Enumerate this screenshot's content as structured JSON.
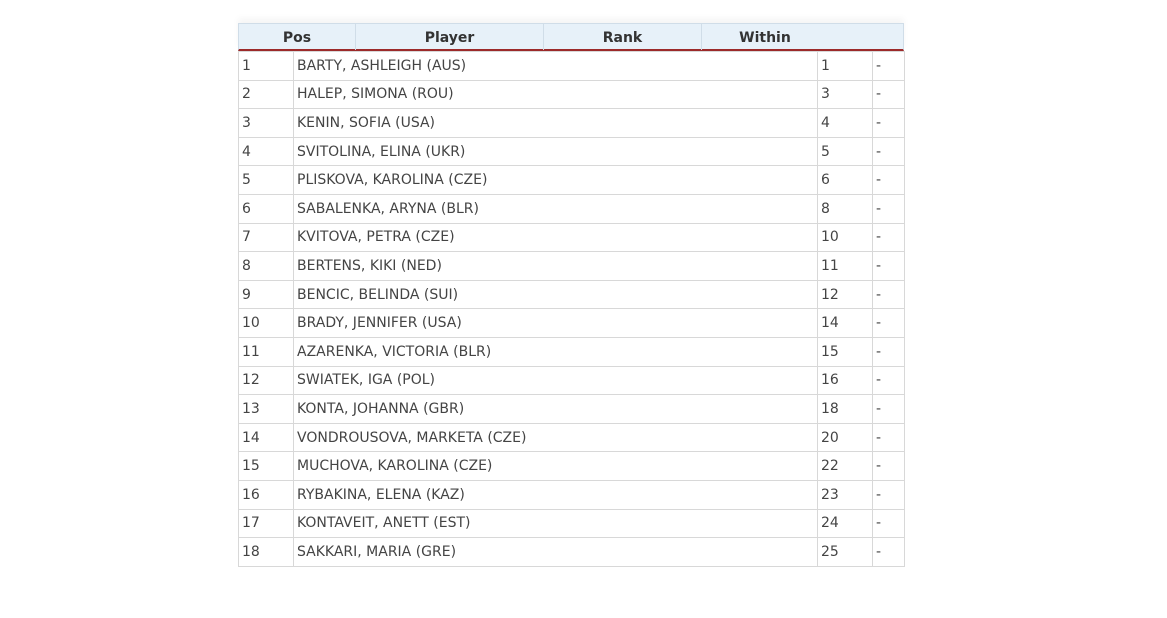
{
  "table": {
    "headers": {
      "pos": "Pos",
      "player": "Player",
      "rank": "Rank",
      "within": "Within"
    },
    "rows": [
      {
        "pos": "1",
        "player": "BARTY, ASHLEIGH (AUS)",
        "rank": "1",
        "within": "-"
      },
      {
        "pos": "2",
        "player": "HALEP, SIMONA (ROU)",
        "rank": "3",
        "within": "-"
      },
      {
        "pos": "3",
        "player": "KENIN, SOFIA (USA)",
        "rank": "4",
        "within": "-"
      },
      {
        "pos": "4",
        "player": "SVITOLINA, ELINA (UKR)",
        "rank": "5",
        "within": "-"
      },
      {
        "pos": "5",
        "player": "PLISKOVA, KAROLINA (CZE)",
        "rank": "6",
        "within": "-"
      },
      {
        "pos": "6",
        "player": "SABALENKA, ARYNA (BLR)",
        "rank": "8",
        "within": "-"
      },
      {
        "pos": "7",
        "player": "KVITOVA, PETRA (CZE)",
        "rank": "10",
        "within": "-"
      },
      {
        "pos": "8",
        "player": "BERTENS, KIKI (NED)",
        "rank": "11",
        "within": "-"
      },
      {
        "pos": "9",
        "player": "BENCIC, BELINDA (SUI)",
        "rank": "12",
        "within": "-"
      },
      {
        "pos": "10",
        "player": "BRADY, JENNIFER (USA)",
        "rank": "14",
        "within": "-"
      },
      {
        "pos": "11",
        "player": "AZARENKA, VICTORIA (BLR)",
        "rank": "15",
        "within": "-"
      },
      {
        "pos": "12",
        "player": "SWIATEK, IGA (POL)",
        "rank": "16",
        "within": "-"
      },
      {
        "pos": "13",
        "player": "KONTA, JOHANNA (GBR)",
        "rank": "18",
        "within": "-"
      },
      {
        "pos": "14",
        "player": "VONDROUSOVA, MARKETA (CZE)",
        "rank": "20",
        "within": "-"
      },
      {
        "pos": "15",
        "player": "MUCHOVA, KAROLINA (CZE)",
        "rank": "22",
        "within": "-"
      },
      {
        "pos": "16",
        "player": "RYBAKINA, ELENA (KAZ)",
        "rank": "23",
        "within": "-"
      },
      {
        "pos": "17",
        "player": "KONTAVEIT, ANETT (EST)",
        "rank": "24",
        "within": "-"
      },
      {
        "pos": "18",
        "player": "SAKKARI, MARIA (GRE)",
        "rank": "25",
        "within": "-"
      }
    ]
  },
  "colors": {
    "header_bg": "#e7f1f9",
    "header_rule": "#9c2a2a",
    "grid": "#d8d8d8"
  }
}
